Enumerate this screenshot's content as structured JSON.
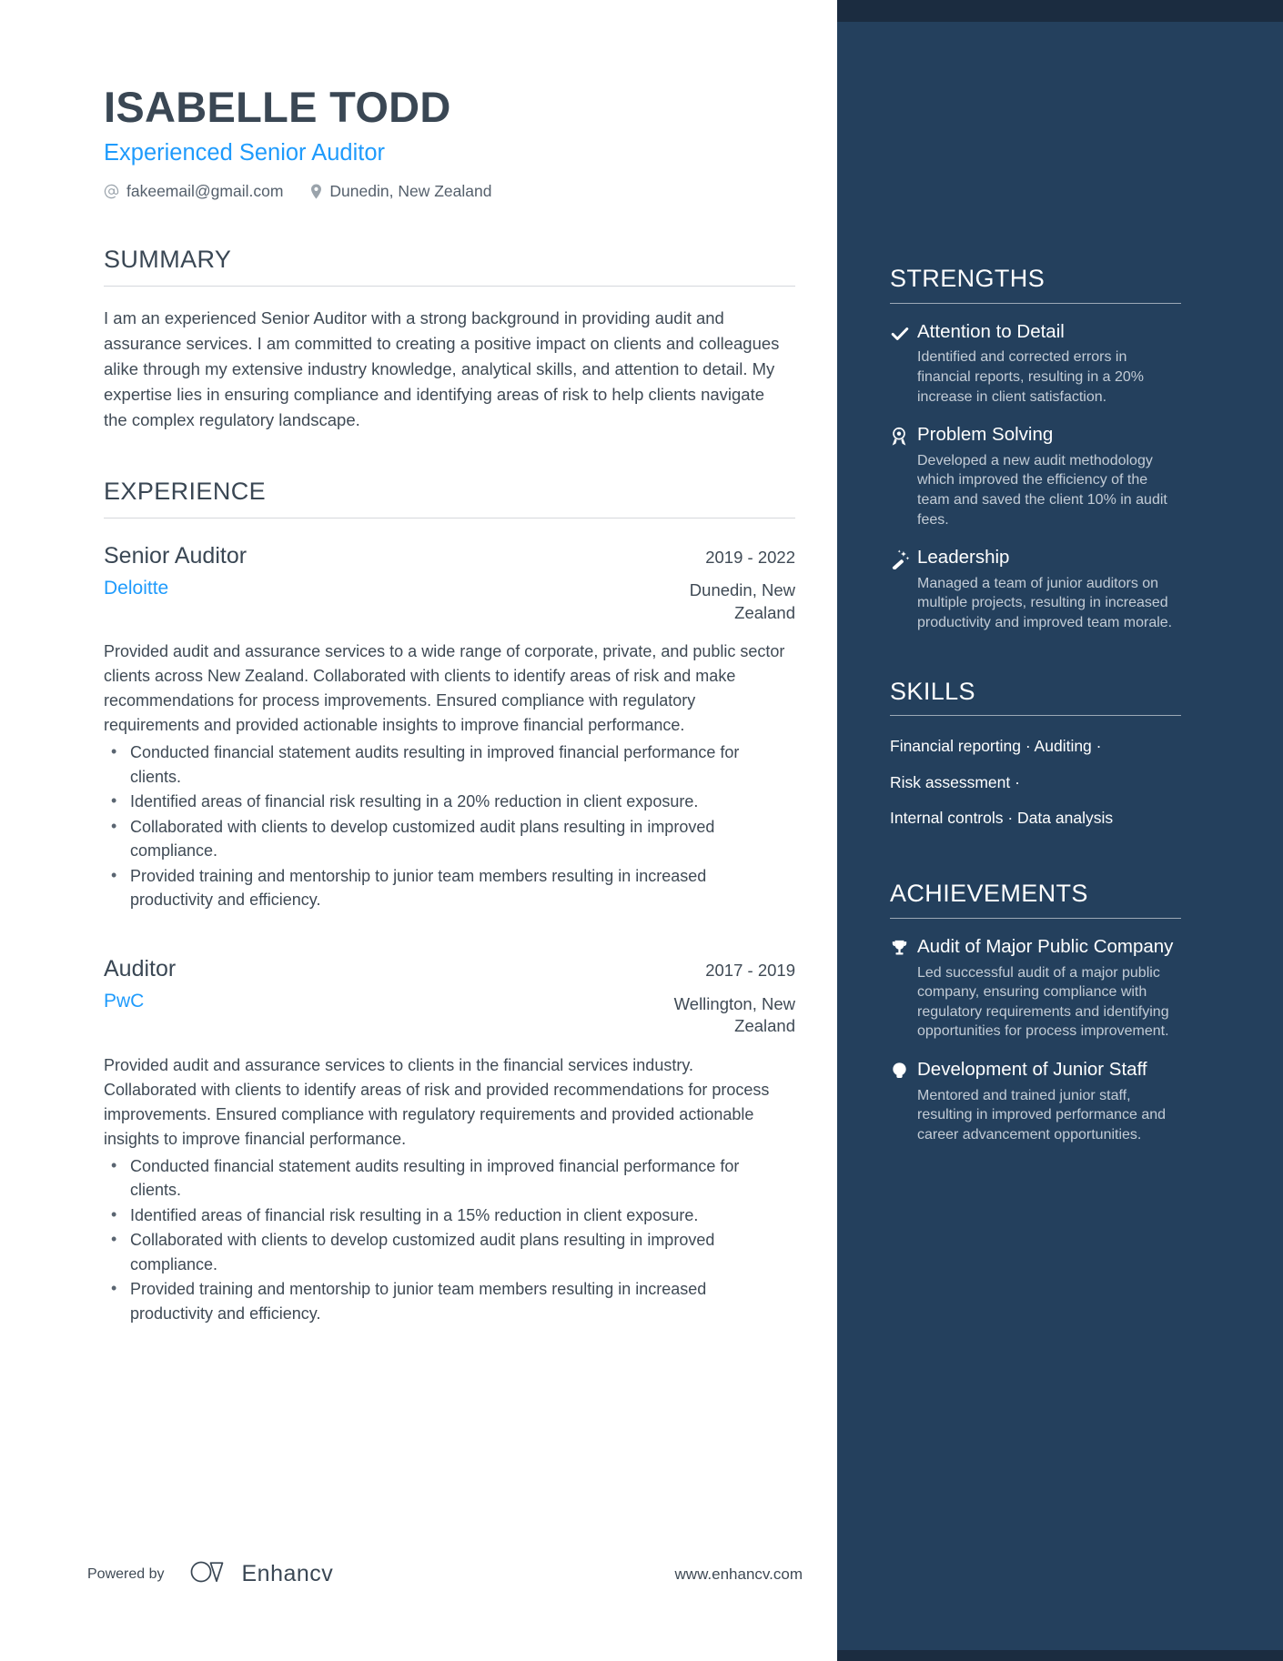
{
  "colors": {
    "accent_blue": "#1f9bfc",
    "sidebar_bg": "#24405d",
    "sidebar_topbar": "#1b2c40",
    "text_dark": "#3a4754",
    "body_text": "#3f4a55",
    "sidebar_desc": "#c3ccd6"
  },
  "header": {
    "name": "ISABELLE TODD",
    "title": "Experienced Senior Auditor",
    "email": "fakeemail@gmail.com",
    "location": "Dunedin, New Zealand"
  },
  "summary": {
    "heading": "SUMMARY",
    "text": "I am an experienced Senior Auditor with a strong background in providing audit and assurance services. I am committed to creating a positive impact on clients and colleagues alike through my extensive industry knowledge, analytical skills, and attention to detail. My expertise lies in ensuring compliance and identifying areas of risk to help clients navigate the complex regulatory landscape."
  },
  "experience": {
    "heading": "EXPERIENCE",
    "jobs": [
      {
        "title": "Senior Auditor",
        "company": "Deloitte",
        "dates": "2019 - 2022",
        "location": "Dunedin, New Zealand",
        "description": "Provided audit and assurance services to a wide range of corporate, private, and public sector clients across New Zealand. Collaborated with clients to identify areas of risk and make recommendations for process improvements. Ensured compliance with regulatory requirements and provided actionable insights to improve financial performance.",
        "bullets": [
          "Conducted financial statement audits resulting in improved financial performance for clients.",
          "Identified areas of financial risk resulting in a 20% reduction in client exposure.",
          "Collaborated with clients to develop customized audit plans resulting in improved compliance.",
          "Provided training and mentorship to junior team members resulting in increased productivity and efficiency."
        ]
      },
      {
        "title": "Auditor",
        "company": "PwC",
        "dates": "2017 - 2019",
        "location": "Wellington, New Zealand",
        "description": "Provided audit and assurance services to clients in the financial services industry. Collaborated with clients to identify areas of risk and provided recommendations for process improvements. Ensured compliance with regulatory requirements and provided actionable insights to improve financial performance.",
        "bullets": [
          "Conducted financial statement audits resulting in improved financial performance for clients.",
          "Identified areas of financial risk resulting in a 15% reduction in client exposure.",
          "Collaborated with clients to develop customized audit plans resulting in improved compliance.",
          "Provided training and mentorship to junior team members resulting in increased productivity and efficiency."
        ]
      }
    ]
  },
  "strengths": {
    "heading": "STRENGTHS",
    "items": [
      {
        "icon": "check-icon",
        "title": "Attention to Detail",
        "desc": "Identified and corrected errors in financial reports, resulting in a 20% increase in client satisfaction."
      },
      {
        "icon": "award-icon",
        "title": "Problem Solving",
        "desc": "Developed a new audit methodology which improved the efficiency of the team and saved the client 10% in audit fees."
      },
      {
        "icon": "magic-wand-icon",
        "title": "Leadership",
        "desc": "Managed a team of junior auditors on multiple projects, resulting in increased productivity and improved team morale."
      }
    ]
  },
  "skills": {
    "heading": "SKILLS",
    "lines": [
      "Financial reporting · Auditing ·",
      "Risk assessment ·",
      "Internal controls · Data analysis"
    ]
  },
  "achievements": {
    "heading": "ACHIEVEMENTS",
    "items": [
      {
        "icon": "trophy-icon",
        "title": "Audit of Major Public Company",
        "desc": "Led successful audit of a major public company, ensuring compliance with regulatory requirements and identifying opportunities for process improvement."
      },
      {
        "icon": "lightbulb-icon",
        "title": "Development of Junior Staff",
        "desc": "Mentored and trained junior staff, resulting in improved performance and career advancement opportunities."
      }
    ]
  },
  "footer": {
    "powered_by": "Powered by",
    "brand": "Enhancv",
    "url": "www.enhancv.com"
  }
}
